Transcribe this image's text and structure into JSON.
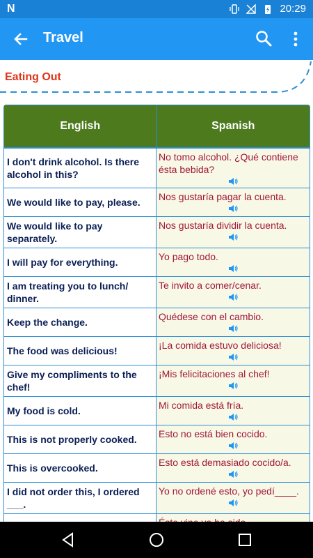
{
  "status_bar": {
    "carrier_icon": "N",
    "time": "20:29"
  },
  "app_bar": {
    "title": "Travel"
  },
  "section": {
    "title": "Eating Out"
  },
  "table": {
    "headers": {
      "english": "English",
      "spanish": "Spanish"
    },
    "rows": [
      {
        "en": "I don't drink alcohol. Is there alcohol in this?",
        "es": "No tomo alcohol. ¿Qué contiene ésta bebida?"
      },
      {
        "en": "We would like to pay, please.",
        "es": "Nos gustaría pagar la cuenta."
      },
      {
        "en": "We would like to pay separately.",
        "es": "Nos gustaría dividir la cuenta."
      },
      {
        "en": "I will pay for everything.",
        "es": "Yo pago todo."
      },
      {
        "en": "I am treating you to lunch/ dinner.",
        "es": "Te invito a comer/cenar."
      },
      {
        "en": "Keep the change.",
        "es": "Quédese con el cambio."
      },
      {
        "en": "The food was delicious!",
        "es": "¡La comida estuvo deliciosa!"
      },
      {
        "en": "Give my compliments to the chef!",
        "es": "¡Mis felicitaciones al chef!"
      },
      {
        "en": "My food is cold.",
        "es": "Mi comida está fría."
      },
      {
        "en": "This is not properly cooked.",
        "es": "Esto no está bien cocido."
      },
      {
        "en": "This is overcooked.",
        "es": "Esto está demasiado cocido/a."
      },
      {
        "en": "I did not order this, I ordered ___.",
        "es": "Yo no ordené esto, yo pedí____."
      },
      {
        "en": "",
        "es": "Éste vino ya ha sido"
      }
    ]
  },
  "colors": {
    "appbar": "#2196f3",
    "statusbar": "#1a82d6",
    "header_green": "#4c7a1d",
    "english_text": "#0b1f55",
    "spanish_text": "#a3173a",
    "section_title": "#e0341c"
  }
}
